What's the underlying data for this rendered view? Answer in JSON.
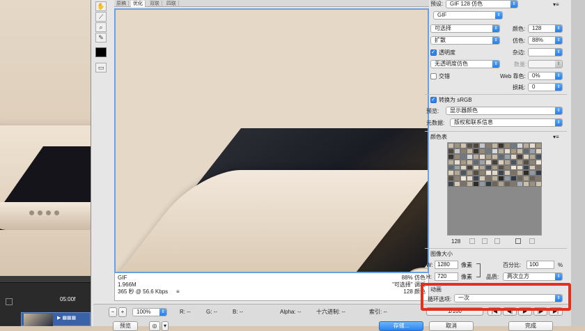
{
  "preview_tabs": [
    "原稿",
    "优化",
    "双联",
    "四联"
  ],
  "active_tab": "优化",
  "preview_info": {
    "format": "GIF",
    "size": "1.966M",
    "time": "365 秒 @ 56.6 Kbps",
    "menu_icon": "≡",
    "dither_pct": "88% 仿色",
    "palette_name": "\"可选择\" 调板",
    "colors": "128 颜色"
  },
  "status_bar": {
    "zoom": "100%",
    "r": "R: --",
    "g": "G: --",
    "b": "B: --",
    "alpha": "Alpha: --",
    "hex": "十六进制: --",
    "index": "索引: --"
  },
  "bottom_buttons": {
    "preview": "预览",
    "save": "存储...",
    "cancel": "取消",
    "done": "完成"
  },
  "settings": {
    "preset_label": "预设:",
    "preset_value": "GIF 128 仿色",
    "format_value": "GIF",
    "reduction_value": "可选择",
    "dither_algo_value": "扩散",
    "colors_label": "颜色:",
    "colors_value": "128",
    "dither_label": "仿色:",
    "dither_value": "88%",
    "transparency_label": "透明度",
    "transparency_checked": true,
    "matte_label": "杂边:",
    "transparency_dither_value": "无透明度仿色",
    "amount_label": "数量:",
    "interlaced_label": "交错",
    "interlaced_checked": false,
    "web_snap_label": "Web 靠色:",
    "web_snap_value": "0%",
    "lossy_label": "损耗:",
    "lossy_value": "0",
    "convert_srgb_label": "转换为 sRGB",
    "convert_srgb_checked": true,
    "preview_label": "预览:",
    "preview_value": "显示器颜色",
    "metadata_label": "元数据:",
    "metadata_value": "版权和联系信息",
    "color_table_label": "颜色表",
    "color_table_count": "128",
    "image_size_label": "图像大小",
    "w_label": "W:",
    "w_value": "1280",
    "h_label": "H:",
    "h_value": "720",
    "px_unit": "像素",
    "percent_label": "百分比:",
    "percent_value": "100",
    "percent_unit": "%",
    "quality_label": "品质:",
    "quality_value": "两次立方",
    "animation_label": "动画",
    "loop_label": "循环选项:",
    "loop_value": "一次",
    "frame_counter": "1/100"
  },
  "timeline": {
    "timecode": "05:00f"
  },
  "palette_colors": [
    "#c9c0b0",
    "#a99e8c",
    "#8a7f6e",
    "#d6cab7",
    "#b8ad9a",
    "#6f6556",
    "#e2d7c5",
    "#9c917f",
    "#574e42",
    "#c3b6a1",
    "#7d7262",
    "#e9dfcf",
    "#b0a38e",
    "#474037",
    "#d1c4ae",
    "#8f8472",
    "#3a352f",
    "#beb19c",
    "#a6997f",
    "#6a6154",
    "#dcd0bc",
    "#5a5248",
    "#f0e7d8",
    "#978b77",
    "#2e2b27",
    "#cabda7",
    "#82776a",
    "#b4a894",
    "#4f483f",
    "#e4d9c6",
    "#707a84",
    "#8f9aa4",
    "#5f6a74",
    "#a9b1b8",
    "#4a545e",
    "#c2c8cc",
    "#3b4550",
    "#d6dadc",
    "#2f3944",
    "#9aa3aa"
  ]
}
